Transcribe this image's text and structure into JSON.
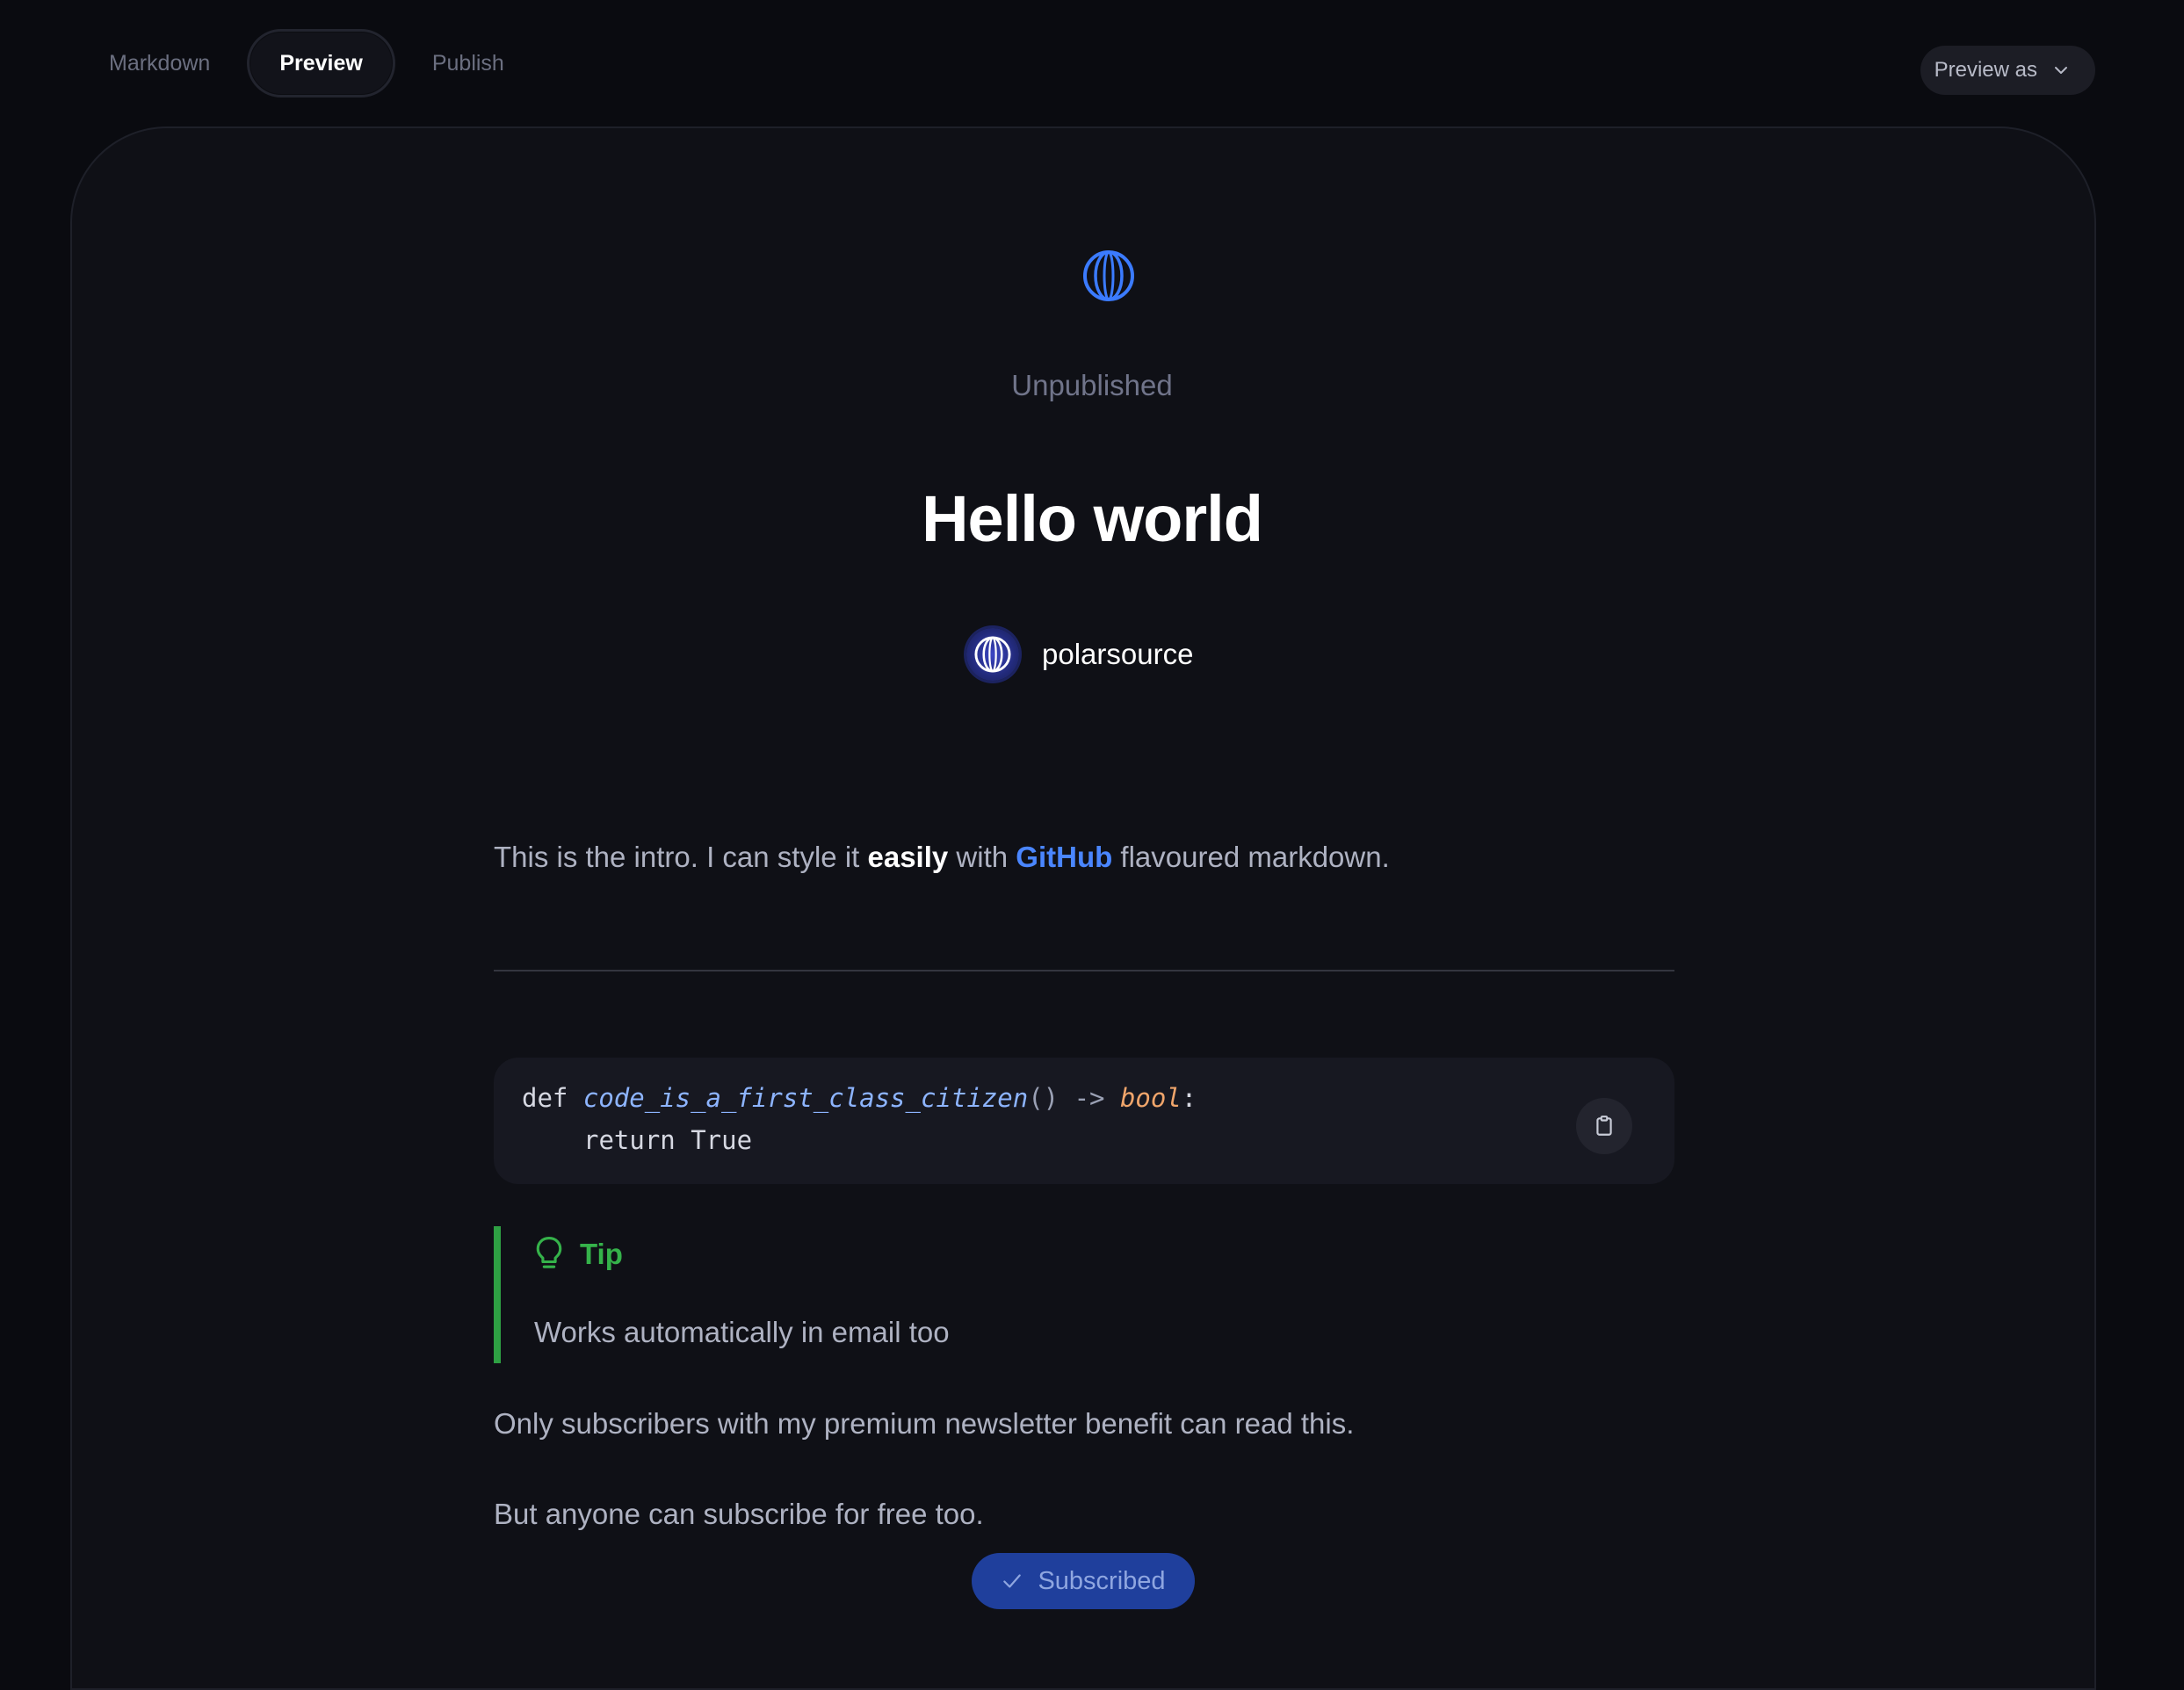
{
  "tabs": [
    {
      "label": "Markdown",
      "active": false
    },
    {
      "label": "Preview",
      "active": true
    },
    {
      "label": "Publish",
      "active": false
    }
  ],
  "preview_as": {
    "label": "Preview as",
    "icon": "chevron-down-icon"
  },
  "post": {
    "logo_icon": "polar-logo-icon",
    "status": "Unpublished",
    "title": "Hello world",
    "author": {
      "name": "polarsource",
      "avatar_icon": "polar-logo-icon"
    },
    "intro": {
      "part1": "This is the intro. I can style it ",
      "bold": "easily",
      "part2": " with ",
      "link": "GitHub",
      "part3": " flavoured markdown."
    },
    "code": {
      "kw_def": "def",
      "fn_name": "code_is_a_first_class_citizen",
      "parens": "()",
      "arrow": " -> ",
      "ret_type": "bool",
      "colon": ":",
      "line2": "return True",
      "copy_icon": "clipboard-icon"
    },
    "tip": {
      "icon": "lightbulb-icon",
      "title": "Tip",
      "body": "Works automatically in email too"
    },
    "paragraph1": "Only subscribers with my premium newsletter benefit can read this.",
    "paragraph2": "But anyone can subscribe for free too.",
    "subscribe_button": {
      "label": "Subscribed",
      "icon": "check-icon"
    }
  },
  "colors": {
    "accent_blue": "#4a86ff",
    "tip_green": "#2ea043",
    "background": "#0a0b10",
    "card": "#0f1016"
  }
}
